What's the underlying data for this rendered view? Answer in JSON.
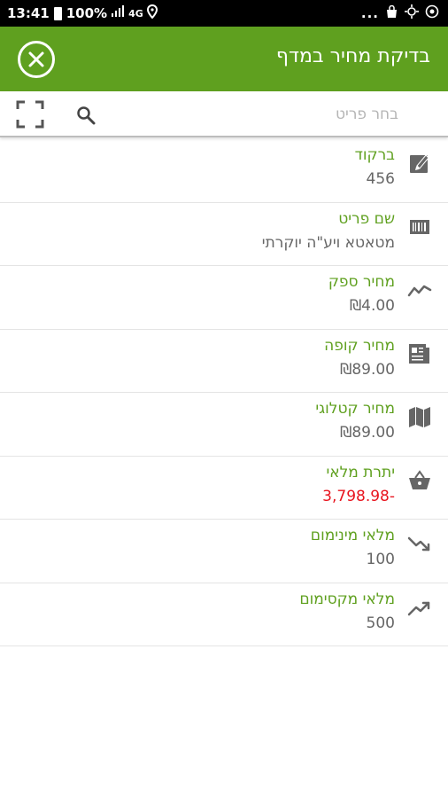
{
  "status_bar": {
    "time": "13:41",
    "battery": "100%",
    "network": "4G",
    "dots": "...",
    "icons": [
      "battery-icon",
      "signal-icon",
      "location-icon",
      "shopping-bag-icon",
      "sync-icon",
      "target-icon"
    ]
  },
  "app_bar": {
    "title": "בדיקת מחיר במדף",
    "background": "#5fa01f"
  },
  "search": {
    "placeholder": "בחר פריט"
  },
  "items": [
    {
      "label": "ברקוד",
      "value": "456",
      "icon": "edit-icon"
    },
    {
      "label": "שם פריט",
      "value": "מטאטא ויע\"ה יוקרתי",
      "icon": "barcode-icon"
    },
    {
      "label": "מחיר ספק",
      "value": "₪4.00",
      "icon": "trending-line-icon"
    },
    {
      "label": "מחיר קופה",
      "value": "₪89.00",
      "icon": "receipt-icon"
    },
    {
      "label": "מחיר קטלוגי",
      "value": "₪89.00",
      "icon": "map-icon"
    },
    {
      "label": "יתרת מלאי",
      "value": "-3,798.98",
      "icon": "basket-icon",
      "value_color": "#e8141e"
    },
    {
      "label": "מלאי מינימום",
      "value": "100",
      "icon": "trending-down-icon"
    },
    {
      "label": "מלאי מקסימום",
      "value": "500",
      "icon": "trending-up-icon"
    }
  ],
  "colors": {
    "accent": "#5fa01f",
    "negative": "#e8141e",
    "value_text": "#666666",
    "icon": "#666666"
  }
}
